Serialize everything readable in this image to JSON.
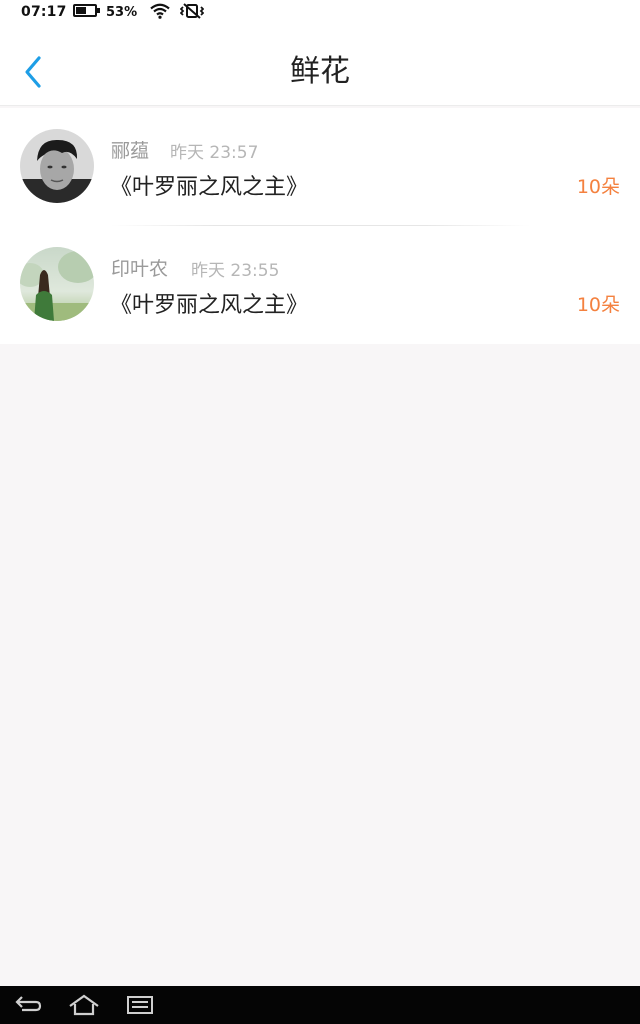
{
  "status_bar": {
    "time": "07:17",
    "battery_percent": "53%",
    "battery_level": 0.53,
    "icons": [
      "battery-icon",
      "wifi-icon",
      "vibrate-mute-icon"
    ]
  },
  "header": {
    "title": "鲜花",
    "back_icon": "chevron-left-icon",
    "accent_color": "#1e9ee6"
  },
  "flowers": [
    {
      "user": "郦蕴",
      "time": "昨天 23:57",
      "book": "《叶罗丽之风之主》",
      "count": "10朵"
    },
    {
      "user": "印叶农",
      "time": "昨天 23:55",
      "book": "《叶罗丽之风之主》",
      "count": "10朵"
    }
  ],
  "colors": {
    "count": "#f4813f",
    "background": "#f8f6f7"
  },
  "nav": {
    "icons": [
      "back-icon",
      "home-icon",
      "menu-icon"
    ]
  }
}
